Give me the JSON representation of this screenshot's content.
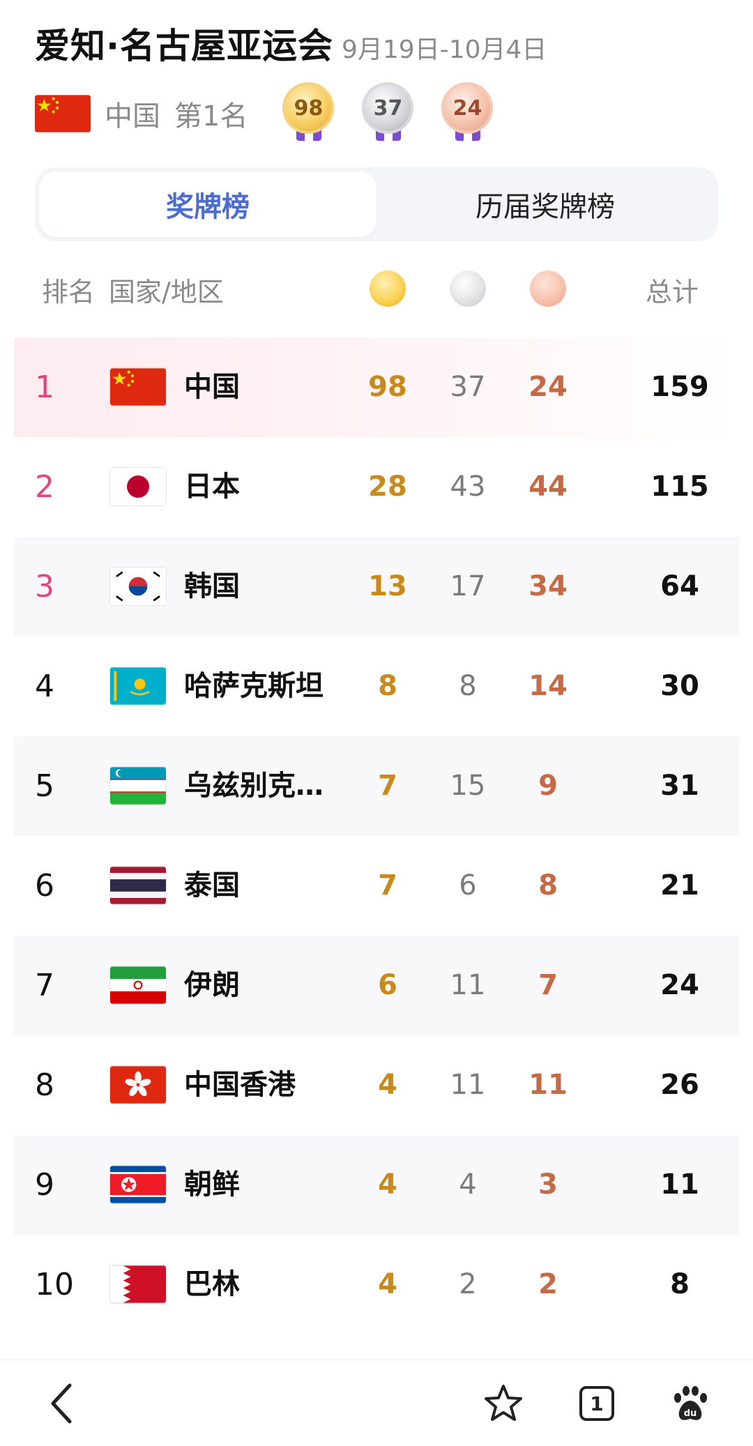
{
  "header": {
    "title": "爱知·名古屋亚运会",
    "date": "9月19日-10月4日"
  },
  "summary": {
    "country": "中国",
    "rank": "第1名",
    "gold": "98",
    "silver": "37",
    "bronze": "24"
  },
  "tabs": [
    "奖牌榜",
    "历届奖牌榜"
  ],
  "columns": {
    "rank": "排名",
    "country": "国家/地区",
    "total": "总计"
  },
  "rows": [
    {
      "rank": "1",
      "country": "中国",
      "gold": "98",
      "silver": "37",
      "bronze": "24",
      "total": "159"
    },
    {
      "rank": "2",
      "country": "日本",
      "gold": "28",
      "silver": "43",
      "bronze": "44",
      "total": "115"
    },
    {
      "rank": "3",
      "country": "韩国",
      "gold": "13",
      "silver": "17",
      "bronze": "34",
      "total": "64"
    },
    {
      "rank": "4",
      "country": "哈萨克斯坦",
      "gold": "8",
      "silver": "8",
      "bronze": "14",
      "total": "30"
    },
    {
      "rank": "5",
      "country": "乌兹别克…",
      "gold": "7",
      "silver": "15",
      "bronze": "9",
      "total": "31"
    },
    {
      "rank": "6",
      "country": "泰国",
      "gold": "7",
      "silver": "6",
      "bronze": "8",
      "total": "21"
    },
    {
      "rank": "7",
      "country": "伊朗",
      "gold": "6",
      "silver": "11",
      "bronze": "7",
      "total": "24"
    },
    {
      "rank": "8",
      "country": "中国香港",
      "gold": "4",
      "silver": "11",
      "bronze": "11",
      "total": "26"
    },
    {
      "rank": "9",
      "country": "朝鲜",
      "gold": "4",
      "silver": "4",
      "bronze": "3",
      "total": "11"
    },
    {
      "rank": "10",
      "country": "巴林",
      "gold": "4",
      "silver": "2",
      "bronze": "2",
      "total": "8"
    }
  ],
  "bottom_bar": {
    "tab_count": "1",
    "icons": [
      "back-arrow-icon",
      "star-icon",
      "tabs-icon",
      "paw-icon"
    ]
  },
  "colors": {
    "accent": "#4a6cd4",
    "rank_top": "#e2447b",
    "gold_text": "#c98a1a",
    "silver_text": "#7b7b7b",
    "bronze_text": "#c56a45"
  }
}
